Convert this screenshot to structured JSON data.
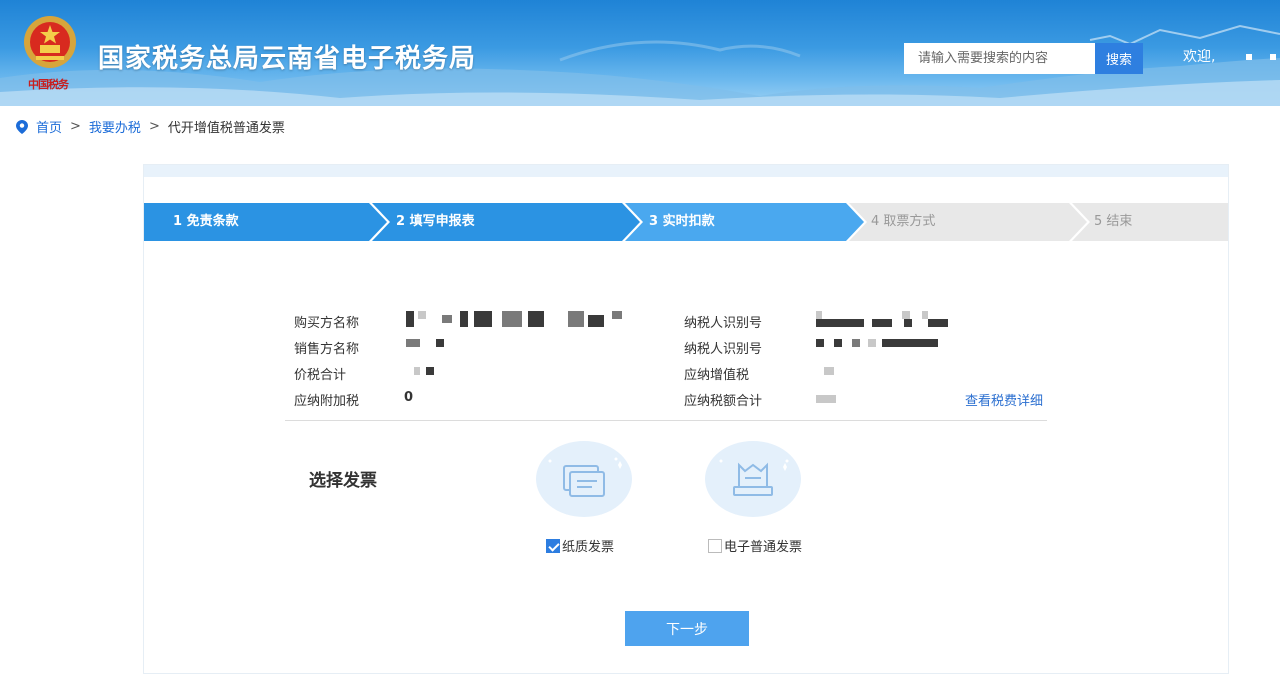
{
  "header": {
    "site_title": "国家税务总局云南省电子税务局",
    "emblem_text": "中国税务",
    "search_placeholder": "请输入需要搜索的内容",
    "search_button": "搜索",
    "welcome": "欢迎,"
  },
  "breadcrumb": {
    "home": "首页",
    "sep": ">",
    "level2": "我要办税",
    "current": "代开增值税普通发票"
  },
  "steps": [
    {
      "label": "1  免责条款",
      "state": "done"
    },
    {
      "label": "2  填写申报表",
      "state": "done"
    },
    {
      "label": "3  实时扣款",
      "state": "active"
    },
    {
      "label": "4  取票方式",
      "state": "todo"
    },
    {
      "label": "5  结束",
      "state": "todo"
    }
  ],
  "info": {
    "buyer_name_label": "购买方名称",
    "seller_name_label": "销售方名称",
    "total_label": "价税合计",
    "surtax_label": "应纳附加税",
    "surtax_value": "0",
    "taxpayer_id_label": "纳税人识别号",
    "taxpayer_id_label2": "纳税人识别号",
    "vat_label": "应纳增值税",
    "tax_total_label": "应纳税额合计",
    "detail_link": "查看税费详细"
  },
  "invoice": {
    "title": "选择发票",
    "paper_label": "纸质发票",
    "paper_checked": true,
    "electronic_label": "电子普通发票",
    "electronic_checked": false
  },
  "actions": {
    "next": "下一步"
  },
  "colors": {
    "header_blue": "#1f83d6",
    "step_done": "#2b93e3",
    "step_active": "#4aa8ef",
    "step_todo": "#e8e8e8",
    "link_blue": "#1c6cd8",
    "button_blue": "#4ea3ee"
  }
}
